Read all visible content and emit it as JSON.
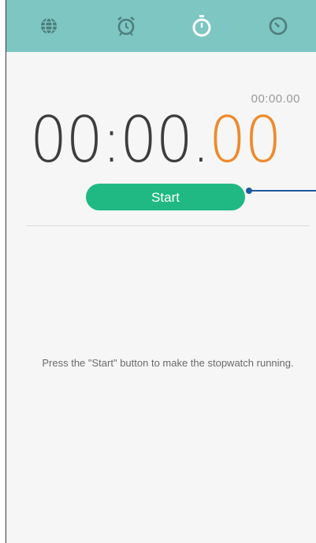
{
  "tabs": [
    {
      "icon": "globe-icon",
      "label": "World clock"
    },
    {
      "icon": "alarm-icon",
      "label": "Alarm"
    },
    {
      "icon": "stopwatch-icon",
      "label": "Stopwatch",
      "active": true
    },
    {
      "icon": "timer-icon",
      "label": "Timer"
    }
  ],
  "stopwatch": {
    "lap_time": "00:00.00",
    "main_time": "00:00.",
    "hundredths": "00",
    "start_label": "Start",
    "hint": "Press the \"Start\" button to make the stopwatch running."
  },
  "colors": {
    "tabbar": "#7dc6c2",
    "start_button": "#20b983",
    "hundredths": "#ee8a2c",
    "callout": "#1e5a9c"
  }
}
